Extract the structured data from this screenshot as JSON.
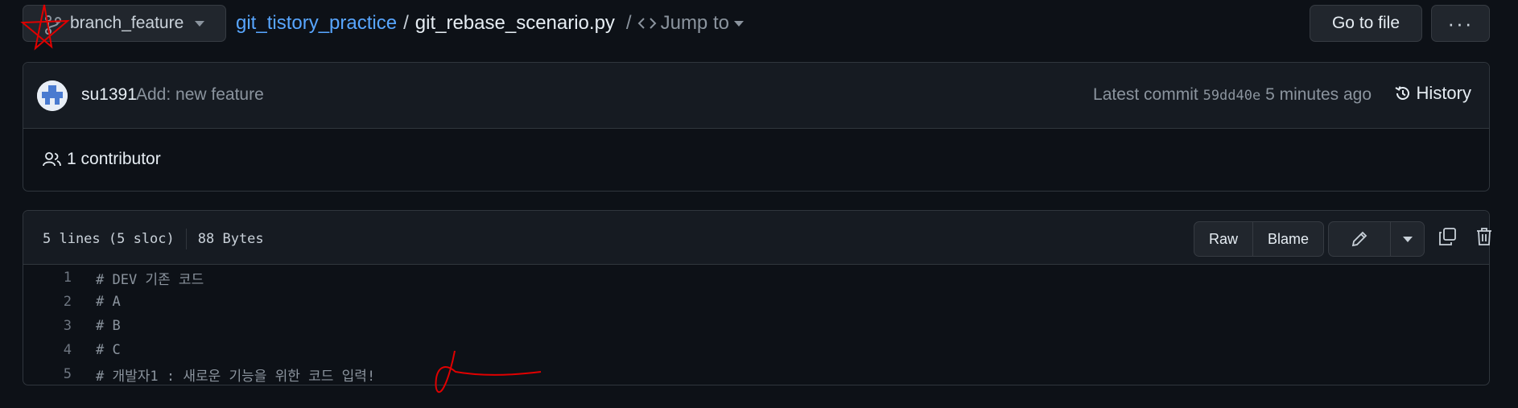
{
  "header": {
    "branch_label": "branch_feature",
    "repo_name": "git_tistory_practice",
    "path_separator": "/",
    "file_name": "git_rebase_scenario.py",
    "jump_separator": "/",
    "jump_label": "Jump to",
    "goto_file_label": "Go to file",
    "more_label": "···"
  },
  "commit": {
    "author": "su1391",
    "message": "Add: new feature",
    "latest_prefix": "Latest commit",
    "sha": "59dd40e",
    "time": "5 minutes ago",
    "history_label": "History",
    "contributors": "1 contributor"
  },
  "file": {
    "lines_info": "5 lines (5 sloc)",
    "size": "88 Bytes",
    "raw_label": "Raw",
    "blame_label": "Blame",
    "lines": [
      {
        "num": "1",
        "text": "# DEV 기존 코드"
      },
      {
        "num": "2",
        "text": "# A"
      },
      {
        "num": "3",
        "text": "# B"
      },
      {
        "num": "4",
        "text": "# C"
      },
      {
        "num": "5",
        "text": "# 개발자1 : 새로운 기능을 위한 코드 입력!"
      }
    ]
  },
  "colors": {
    "background": "#0d1117",
    "panel": "#161b22",
    "border": "#30363d",
    "link": "#58a6ff",
    "annotation": "#e00000"
  },
  "icons": [
    "git-branch-icon",
    "kebab-icon",
    "history-icon",
    "people-icon",
    "pencil-icon",
    "copy-icon",
    "trash-icon",
    "caret-down-icon",
    "code-icon"
  ]
}
